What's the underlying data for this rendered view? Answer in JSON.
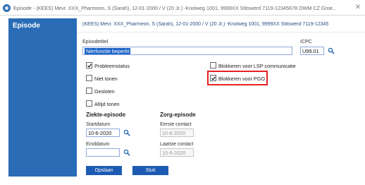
{
  "window": {
    "title": "Episode - (KEES) Mevr. XXX_Pharmeon, S (Sarah), 12-01-2000 / V (20 Jr.) -Knolweg 1001, 9999XX Stitswerd 7119-12345678 OWM CZ Groe...",
    "close_glyph": "✕"
  },
  "sidebar": {
    "title": "Episode"
  },
  "patient": {
    "header": "(KEES) Mevr. XXX_Pharmeon, S (Sarah), 12-01-2000 / V (20 Jr.) -Knolweg 1001, 9999XX Stitswerd 7119-12345"
  },
  "form": {
    "episodetitel": {
      "label": "Episodetitel",
      "value": "Nierfunctie beperkt"
    },
    "icpc": {
      "label": "ICPC",
      "value": "U99.01"
    },
    "checkboxes": [
      {
        "label": "Probleemstatus",
        "checked": true
      },
      {
        "label": "Niet tonen",
        "checked": false
      },
      {
        "label": "Gesloten",
        "checked": false
      },
      {
        "label": "Altijd tonen",
        "checked": false
      },
      {
        "label": "Blokkeren voor LSP communicatie",
        "checked": false
      },
      {
        "label": "Blokkeren voor PGO",
        "checked": true
      }
    ],
    "ziekte": {
      "heading": "Ziekte-episode",
      "startdatum": {
        "label": "Startdatum",
        "value": "10-6-2020"
      },
      "einddatum": {
        "label": "Einddatum",
        "value": ""
      }
    },
    "zorg": {
      "heading": "Zorg-episode",
      "eerste_contact": {
        "label": "Eerste contact",
        "value": "10-6-2020"
      },
      "laatste_contact": {
        "label": "Laatste contact",
        "value": "10-6-2020"
      }
    }
  },
  "buttons": {
    "save": "Opslaan",
    "close": "Sluit"
  },
  "colors": {
    "accent": "#2a6db6",
    "highlight": "#e82222"
  },
  "icons": [
    "app-icon",
    "search-icon",
    "close-icon"
  ]
}
